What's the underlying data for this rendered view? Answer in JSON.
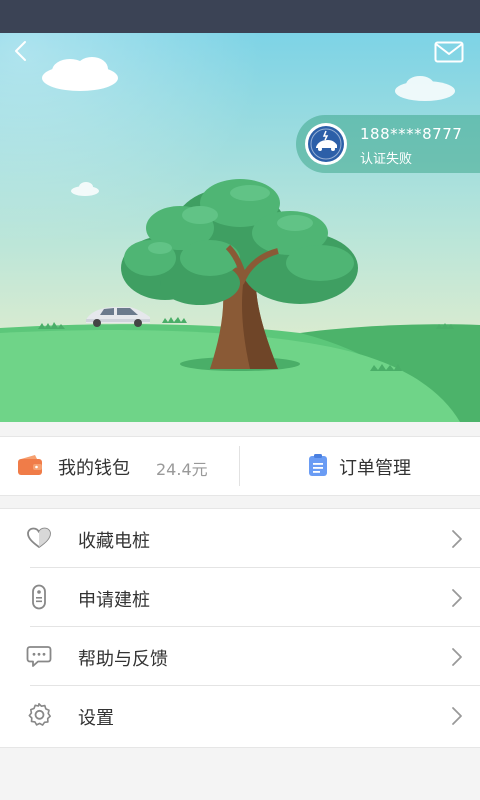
{
  "account": {
    "phone": "188****8777",
    "auth_status": "认证失败"
  },
  "wallet": {
    "label": "我的钱包",
    "amount": "24.4元"
  },
  "orders": {
    "label": "订单管理"
  },
  "menu": {
    "items": [
      {
        "label": "收藏电桩",
        "icon": "heart-icon"
      },
      {
        "label": "申请建桩",
        "icon": "charging-pile-icon"
      },
      {
        "label": "帮助与反馈",
        "icon": "chat-bubble-icon"
      },
      {
        "label": "设置",
        "icon": "gear-icon"
      }
    ]
  },
  "colors": {
    "status_bar": "#3b4355",
    "sky_top": "#7dd3e6",
    "sky_bottom": "#f4f0c8",
    "grass": "#5cc77a",
    "badge": "#40a88c",
    "wallet_icon": "#f07c48",
    "orders_icon": "#6a9cf4"
  }
}
